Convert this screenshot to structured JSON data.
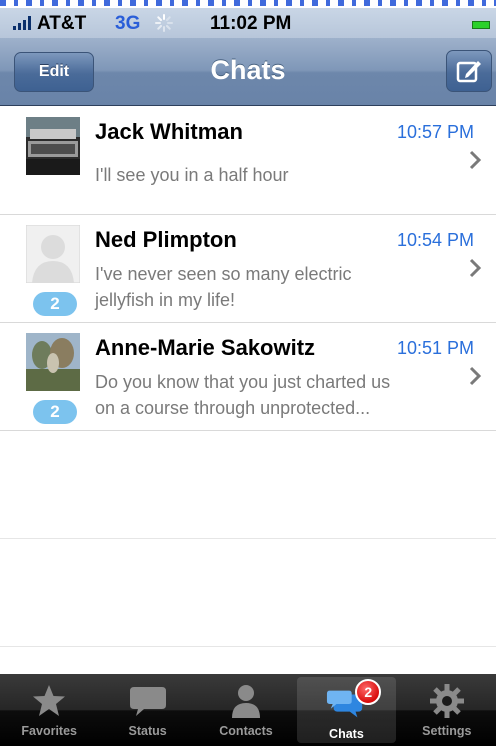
{
  "status_bar": {
    "carrier": "AT&T",
    "network": "3G",
    "time": "11:02 PM"
  },
  "nav": {
    "edit_label": "Edit",
    "title": "Chats",
    "compose_icon": "compose-icon"
  },
  "chats": [
    {
      "name": "Jack Whitman",
      "time": "10:57 PM",
      "preview": "I'll see you in a half hour",
      "unread": ""
    },
    {
      "name": "Ned Plimpton",
      "time": "10:54 PM",
      "preview": "I've never seen so many electric\njellyfish in my life!",
      "unread": "2"
    },
    {
      "name": "Anne-Marie Sakowitz",
      "time": "10:51 PM",
      "preview": "Do you know that you just charted us\non a course through unprotected...",
      "unread": "2"
    }
  ],
  "tabs": [
    {
      "label": "Favorites",
      "icon": "star-icon"
    },
    {
      "label": "Status",
      "icon": "speech-bubble-icon"
    },
    {
      "label": "Contacts",
      "icon": "person-icon"
    },
    {
      "label": "Chats",
      "icon": "chat-bubbles-icon",
      "badge": "2"
    },
    {
      "label": "Settings",
      "icon": "gear-icon"
    }
  ],
  "colors": {
    "accent_time": "#2a6fdb",
    "badge_blue": "#7cc3ee",
    "badge_red": "#d80c0c",
    "network_blue": "#2a5ed8",
    "battery_green": "#2bd12b"
  }
}
